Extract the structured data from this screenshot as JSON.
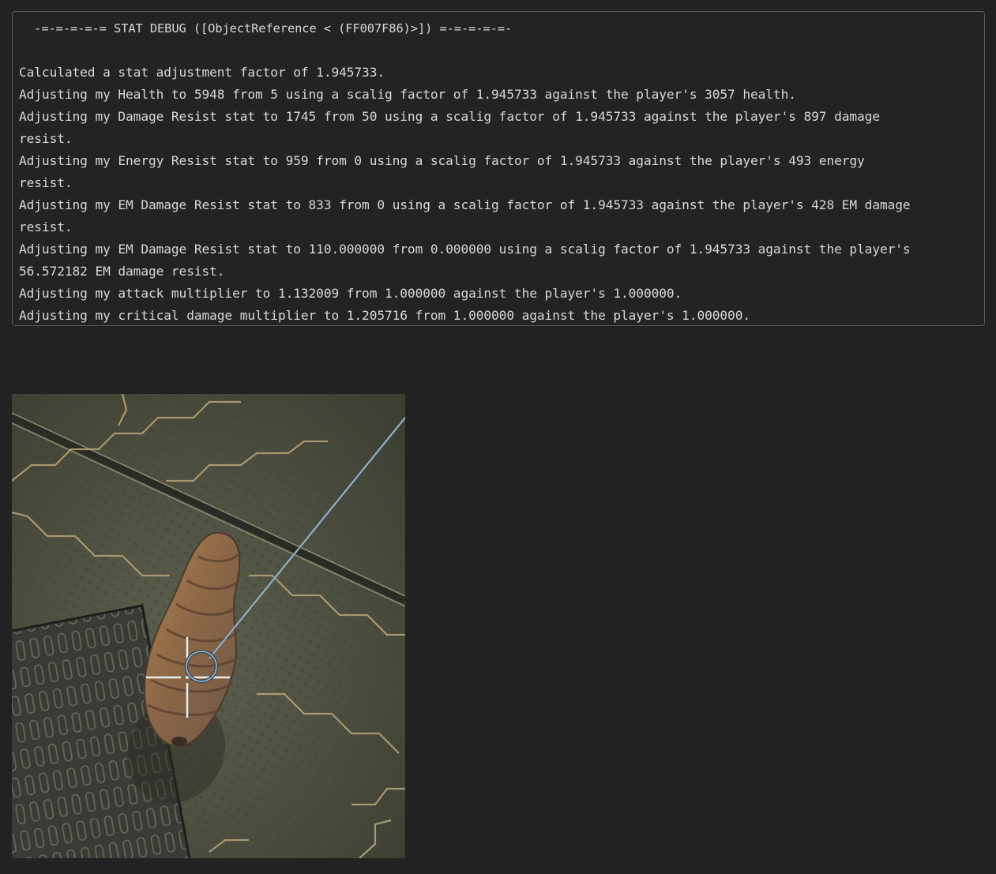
{
  "debug_log": {
    "lines": [
      " -=-=-=-=-= STAT DEBUG ([ObjectReference < (FF007F86)>]) =-=-=-=-=-",
      "",
      "Calculated a stat adjustment factor of 1.945733.",
      "Adjusting my Health to 5948 from 5 using a scalig factor of 1.945733 against the player's 3057 health.",
      "Adjusting my Damage Resist stat to 1745 from 50 using a scalig factor of 1.945733 against the player's 897 damage",
      "resist.",
      "Adjusting my Energy Resist stat to 959 from 0 using a scalig factor of 1.945733 against the player's 493 energy",
      "resist.",
      "Adjusting my EM Damage Resist stat to 833 from 0 using a scalig factor of 1.945733 against the player's 428 EM damage",
      "resist.",
      "Adjusting my EM Damage Resist stat to 110.000000 from 0.000000 using a scalig factor of 1.945733 against the player's",
      "56.572182 EM damage resist.",
      "Adjusting my attack multiplier to 1.132009 from 1.000000 against the player's 1.000000.",
      "Adjusting my critical damage multiplier to 1.205716 from 1.000000 against the player's 1.000000."
    ]
  },
  "colors": {
    "page_background": "#222222",
    "code_border": "#5c5c5c",
    "code_text": "#d8d8d8",
    "floor": "#4e5040",
    "creature": "#8a6a4a",
    "crosshair": "#e8eef0",
    "aim_line": "#6f8fa8"
  }
}
